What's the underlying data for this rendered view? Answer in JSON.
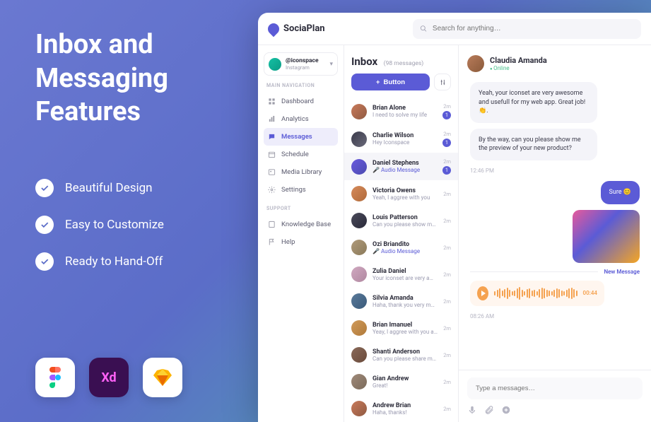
{
  "promo": {
    "title": "Inbox and Messaging Features",
    "features": [
      "Beautiful Design",
      "Easy to Customize",
      "Ready to Hand-Off"
    ]
  },
  "brand": {
    "name": "SociaPlan"
  },
  "search": {
    "placeholder": "Search for anything…"
  },
  "account": {
    "handle": "@iconspace",
    "platform": "Instagram"
  },
  "nav": {
    "main_heading": "MAIN NAVIGATION",
    "support_heading": "SUPPORT",
    "items": [
      {
        "label": "Dashboard"
      },
      {
        "label": "Analytics"
      },
      {
        "label": "Messages"
      },
      {
        "label": "Schedule"
      },
      {
        "label": "Media Library"
      },
      {
        "label": "Settings"
      }
    ],
    "support": [
      {
        "label": "Knowledge Base"
      },
      {
        "label": "Help"
      }
    ]
  },
  "inbox": {
    "title": "Inbox",
    "count_label": "(98 messages)",
    "button_label": "Button",
    "threads": [
      {
        "name": "Brian Alone",
        "preview": "I need to solve my life",
        "time": "2m",
        "unread": 1
      },
      {
        "name": "Charlie Wilson",
        "preview": "Hey Iconspace",
        "time": "2m",
        "unread": 1
      },
      {
        "name": "Daniel Stephens",
        "preview": "Audio Message",
        "time": "2m",
        "unread": 1,
        "audio": true
      },
      {
        "name": "Victoria Owens",
        "preview": "Yeah, I aggree with you",
        "time": "2m"
      },
      {
        "name": "Louis Patterson",
        "preview": "Can you please show m…",
        "time": "2m"
      },
      {
        "name": "Ozi Briandito",
        "preview": "Audio Message",
        "time": "2m",
        "audio": true
      },
      {
        "name": "Zulia Daniel",
        "preview": "Your iconset are very a…",
        "time": "2m"
      },
      {
        "name": "Silvia Amanda",
        "preview": "Haha, thank you very m…",
        "time": "2m"
      },
      {
        "name": "Brian Imanuel",
        "preview": "Yeay, I aggree with you abou…",
        "time": "2m"
      },
      {
        "name": "Shanti Anderson",
        "preview": "Can you please share m…",
        "time": "2m"
      },
      {
        "name": "Gian Andrew",
        "preview": "Great!",
        "time": "2m"
      },
      {
        "name": "Andrew Brian",
        "preview": "Haha, thanks!",
        "time": "2m"
      }
    ]
  },
  "chat": {
    "name": "Claudia Amanda",
    "status": "Online",
    "messages": {
      "m1": "Yeah, your iconset are very awesome and usefull for my web app. Great job! 👏.",
      "m2": "By the way, can you please show me the preview of your new product?",
      "t1": "12:46 PM",
      "m3": "Sure 😊",
      "divider": "New Message",
      "voice_dur": "00:44",
      "t2": "08:26 AM"
    },
    "composer_placeholder": "Type a messages…"
  }
}
